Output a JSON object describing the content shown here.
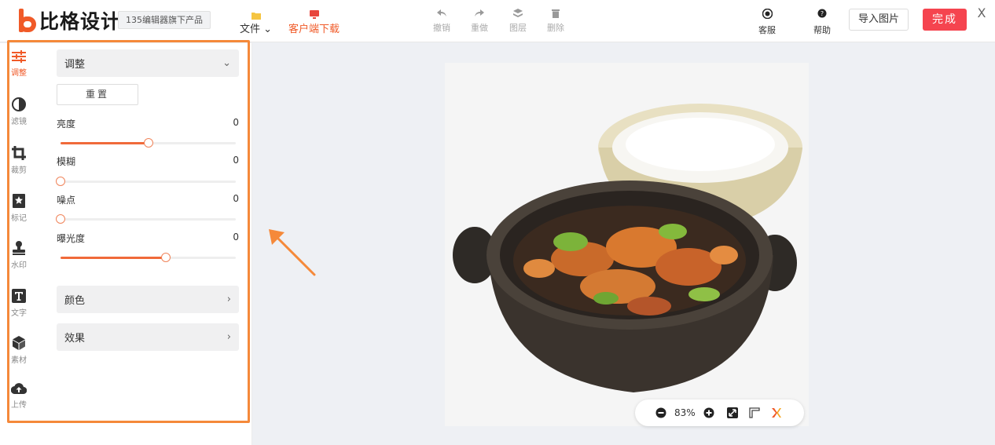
{
  "header": {
    "brand_name": "比格设计",
    "tagline": "135编辑器旗下产品",
    "file_menu": "文件",
    "client_download": "客户端下载",
    "toolbar": {
      "undo": "撤销",
      "redo": "重做",
      "layers": "图层",
      "delete": "删除"
    },
    "service": "客服",
    "help": "帮助",
    "import_image": "导入图片",
    "done": "完成",
    "close": "X"
  },
  "rail": {
    "items": [
      {
        "label": "调整",
        "icon": "sliders-icon",
        "active": true
      },
      {
        "label": "滤镜",
        "icon": "filter-half-circle-icon",
        "active": false
      },
      {
        "label": "裁剪",
        "icon": "crop-icon",
        "active": false
      },
      {
        "label": "标记",
        "icon": "star-bookmark-icon",
        "active": false
      },
      {
        "label": "水印",
        "icon": "stamp-icon",
        "active": false
      },
      {
        "label": "文字",
        "icon": "text-icon",
        "active": false
      },
      {
        "label": "素材",
        "icon": "cube-icon",
        "active": false
      },
      {
        "label": "上传",
        "icon": "cloud-upload-icon",
        "active": false
      }
    ]
  },
  "panel": {
    "adjust_title": "调整",
    "reset": "重置",
    "sliders": [
      {
        "label": "亮度",
        "value": "0",
        "level": 0.5
      },
      {
        "label": "模糊",
        "value": "0",
        "level": 0
      },
      {
        "label": "噪点",
        "value": "0",
        "level": 0
      },
      {
        "label": "曝光度",
        "value": "0",
        "level": 0.6
      }
    ],
    "color_section": "颜色",
    "effects_section": "效果"
  },
  "zoom": {
    "value": "83%"
  },
  "colors": {
    "accent": "#f05a28",
    "done_button": "#f5444f",
    "highlight": "#f5893a"
  }
}
